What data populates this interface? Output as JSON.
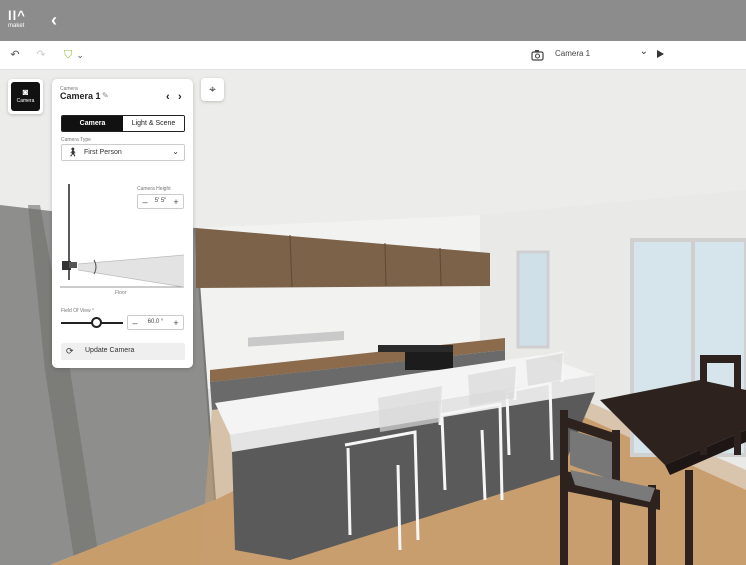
{
  "topbar": {
    "logo_mark": "ll^",
    "logo_text": "maket",
    "back_icon": "chevron-left-icon"
  },
  "toolbar": {
    "undo_icon": "undo-icon",
    "redo_icon": "redo-icon",
    "camera_dropdown": {
      "label": "Camera 1"
    }
  },
  "camera_tool": {
    "label": "Camera"
  },
  "panel": {
    "category": "Camera",
    "title": "Camera 1",
    "tabs": [
      {
        "label": "Camera",
        "active": true
      },
      {
        "label": "Light & Scene",
        "active": false
      }
    ],
    "camera_type": {
      "label": "Camera Type",
      "value": "First Person"
    },
    "camera_height": {
      "label": "Camera Height",
      "value": "5' 5\""
    },
    "floor_label": "Floor",
    "field_of_view": {
      "label": "Field Of View °",
      "value": "60.0 °"
    },
    "update_button": "Update Camera"
  },
  "colors": {
    "topbar": "#8c8c8c",
    "accent": "#111111",
    "floor": "#c89d6c",
    "island": "#5a5a5a",
    "table": "#2d221d"
  }
}
